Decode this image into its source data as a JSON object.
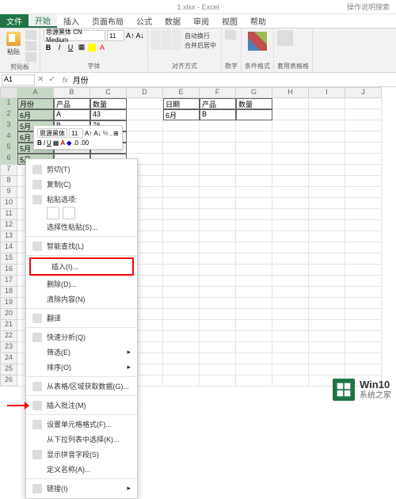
{
  "titlebar": {
    "title": "1.xlsx - Excel",
    "help": "操作说明搜索"
  },
  "tabs": {
    "file": "文件",
    "items": [
      "开始",
      "插入",
      "页面布局",
      "公式",
      "数据",
      "审阅",
      "视图",
      "帮助"
    ],
    "active_index": 0
  },
  "ribbon": {
    "paste_label": "粘贴",
    "clipboard_label": "剪贴板",
    "font_name": "思源黑体 CN Medium",
    "font_size": "11",
    "font_label": "字体",
    "align_wrap": "自动换行",
    "align_merge": "合并后居中",
    "align_label": "对齐方式",
    "number_label": "数字",
    "cond_fmt": "条件格式",
    "table_fmt": "套用表格格"
  },
  "namebox": {
    "cell_ref": "A1",
    "formula_value": "月份"
  },
  "columns": [
    "A",
    "B",
    "C",
    "D",
    "E",
    "F",
    "G",
    "H",
    "I",
    "J"
  ],
  "rows_count": 26,
  "table_data": {
    "left": [
      [
        "月份",
        "产品",
        "数量"
      ],
      [
        "6月",
        "A",
        "43"
      ],
      [
        "5月",
        "B",
        "76"
      ],
      [
        "6月",
        "",
        ""
      ],
      [
        "5月",
        "",
        ""
      ],
      [
        "5月",
        "",
        ""
      ]
    ],
    "right": [
      [
        "日期",
        "产品",
        "数量"
      ],
      [
        "6月",
        "B",
        ""
      ]
    ]
  },
  "mini_toolbar": {
    "font_name": "思源黑体",
    "font_size": "11"
  },
  "context_menu": {
    "items": [
      {
        "label": "剪切(T)",
        "icon": "cut-icon"
      },
      {
        "label": "复制(C)",
        "icon": "copy-icon"
      },
      {
        "label": "粘贴选项:",
        "icon": "paste-icon",
        "has_sub": true
      },
      {
        "label": "选择性粘贴(S)...",
        "icon": ""
      },
      {
        "sep": true
      },
      {
        "label": "智能查找(L)",
        "icon": "lookup-icon"
      },
      {
        "sep": true
      },
      {
        "label": "插入(I)...",
        "icon": "",
        "highlight": true
      },
      {
        "label": "删除(D)...",
        "icon": ""
      },
      {
        "label": "清除内容(N)",
        "icon": ""
      },
      {
        "sep": true
      },
      {
        "label": "翻译",
        "icon": "translate-icon"
      },
      {
        "sep": true
      },
      {
        "label": "快速分析(Q)",
        "icon": "analysis-icon"
      },
      {
        "label": "筛选(E)",
        "icon": "",
        "arrow": true
      },
      {
        "label": "排序(O)",
        "icon": "",
        "arrow": true
      },
      {
        "sep": true
      },
      {
        "label": "从表格/区域获取数据(G)...",
        "icon": "table-icon"
      },
      {
        "sep": true
      },
      {
        "label": "插入批注(M)",
        "icon": "comment-icon"
      },
      {
        "sep": true
      },
      {
        "label": "设置单元格格式(F)...",
        "icon": "format-icon"
      },
      {
        "label": "从下拉列表中选择(K)...",
        "icon": ""
      },
      {
        "label": "显示拼音字段(S)",
        "icon": "pinyin-icon"
      },
      {
        "label": "定义名称(A)...",
        "icon": ""
      },
      {
        "sep": true
      },
      {
        "label": "链接(I)",
        "icon": "link-icon",
        "arrow": true
      }
    ]
  },
  "watermark": {
    "line1": "Win10",
    "line2": "系统之家"
  }
}
